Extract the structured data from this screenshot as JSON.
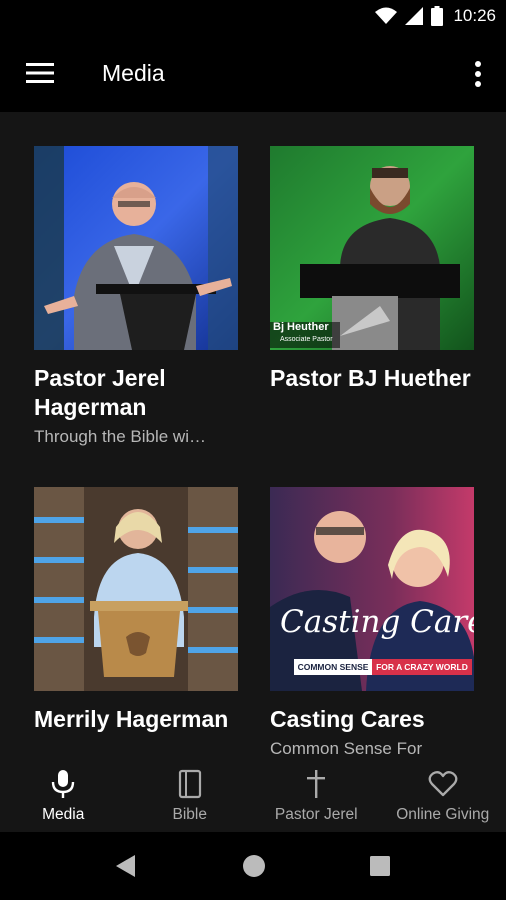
{
  "status": {
    "time": "10:26"
  },
  "app_bar": {
    "title": "Media"
  },
  "cards": [
    {
      "title": "Pastor Jerel Hagerman",
      "subtitle": "Through the Bible wi…"
    },
    {
      "title": "Pastor BJ Huether",
      "subtitle": "",
      "caption_name": "Bj Heuther",
      "caption_role": "Associate Pastor"
    },
    {
      "title": "Merrily Hagerman",
      "subtitle": ""
    },
    {
      "title": "Casting Cares",
      "subtitle": "Common Sense For",
      "artwork_title": "Casting Cares",
      "artwork_tag_left": "COMMON SENSE",
      "artwork_tag_right": "FOR A CRAZY WORLD"
    }
  ],
  "bottom_nav": [
    {
      "label": "Media",
      "icon": "microphone-icon",
      "active": true
    },
    {
      "label": "Bible",
      "icon": "book-icon",
      "active": false
    },
    {
      "label": "Pastor Jerel",
      "icon": "cross-icon",
      "active": false
    },
    {
      "label": "Online Giving",
      "icon": "heart-icon",
      "active": false
    }
  ],
  "colors": {
    "background": "#151515",
    "bar": "#000000",
    "active": "#ffffff",
    "inactive": "#aaaaaa"
  }
}
